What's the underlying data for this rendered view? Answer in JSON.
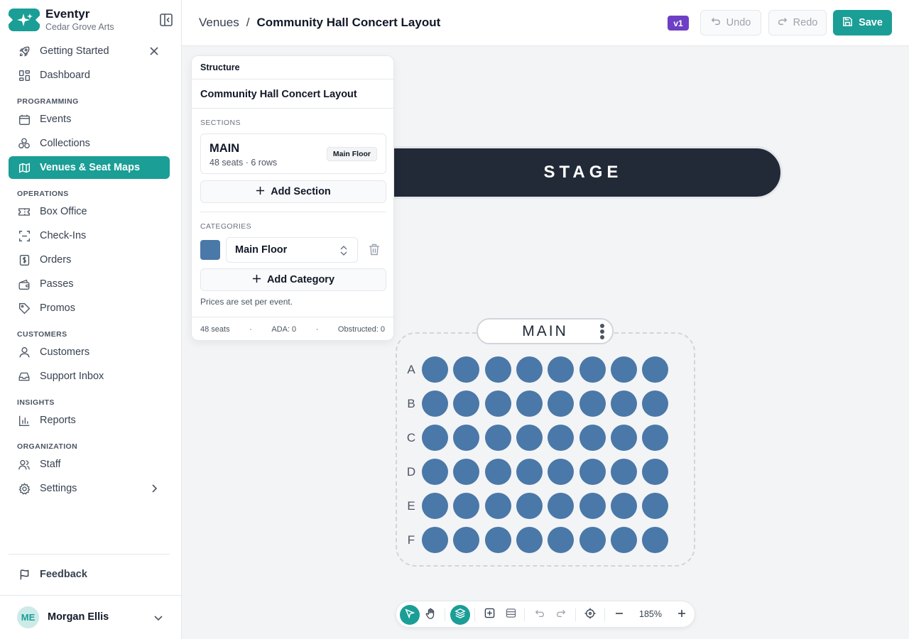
{
  "brand": {
    "name": "Eventyr",
    "org": "Cedar Grove Arts"
  },
  "sidebar": {
    "getting_started": "Getting Started",
    "dashboard": "Dashboard",
    "groups": {
      "programming": "PROGRAMMING",
      "operations": "OPERATIONS",
      "customers": "CUSTOMERS",
      "insights": "INSIGHTS",
      "organization": "ORGANIZATION"
    },
    "items": {
      "events": "Events",
      "collections": "Collections",
      "venues": "Venues & Seat Maps",
      "box_office": "Box Office",
      "check_ins": "Check-Ins",
      "orders": "Orders",
      "passes": "Passes",
      "promos": "Promos",
      "customers": "Customers",
      "support_inbox": "Support Inbox",
      "reports": "Reports",
      "staff": "Staff",
      "settings": "Settings"
    },
    "feedback": "Feedback",
    "user": {
      "initials": "ME",
      "name": "Morgan Ellis"
    }
  },
  "header": {
    "breadcrumb_parent": "Venues",
    "breadcrumb_sep": "/",
    "breadcrumb_current": "Community Hall Concert Layout",
    "version": "v1",
    "undo": "Undo",
    "redo": "Redo",
    "save": "Save"
  },
  "canvas": {
    "stage_label": "STAGE",
    "section_label": "MAIN",
    "rows": [
      "A",
      "B",
      "C",
      "D",
      "E",
      "F"
    ],
    "seats_per_row": 8,
    "seat_color": "#4a78a8"
  },
  "structure": {
    "title": "Structure",
    "layout_name": "Community Hall Concert Layout",
    "sections_heading": "SECTIONS",
    "section": {
      "name": "MAIN",
      "meta": "48 seats · 6 rows",
      "category": "Main Floor"
    },
    "add_section": "Add Section",
    "categories_heading": "CATEGORIES",
    "category_selected": "Main Floor",
    "category_color": "#4a78a8",
    "add_category": "Add Category",
    "note": "Prices are set per event.",
    "footer": {
      "seats": "48 seats",
      "dot": "·",
      "ada": "ADA: 0",
      "obstructed": "Obstructed: 0"
    }
  },
  "toolbar": {
    "zoom": "185%"
  },
  "colors": {
    "accent": "#1a9e96",
    "version_badge": "#6d3fc5",
    "stage": "#222a38"
  }
}
